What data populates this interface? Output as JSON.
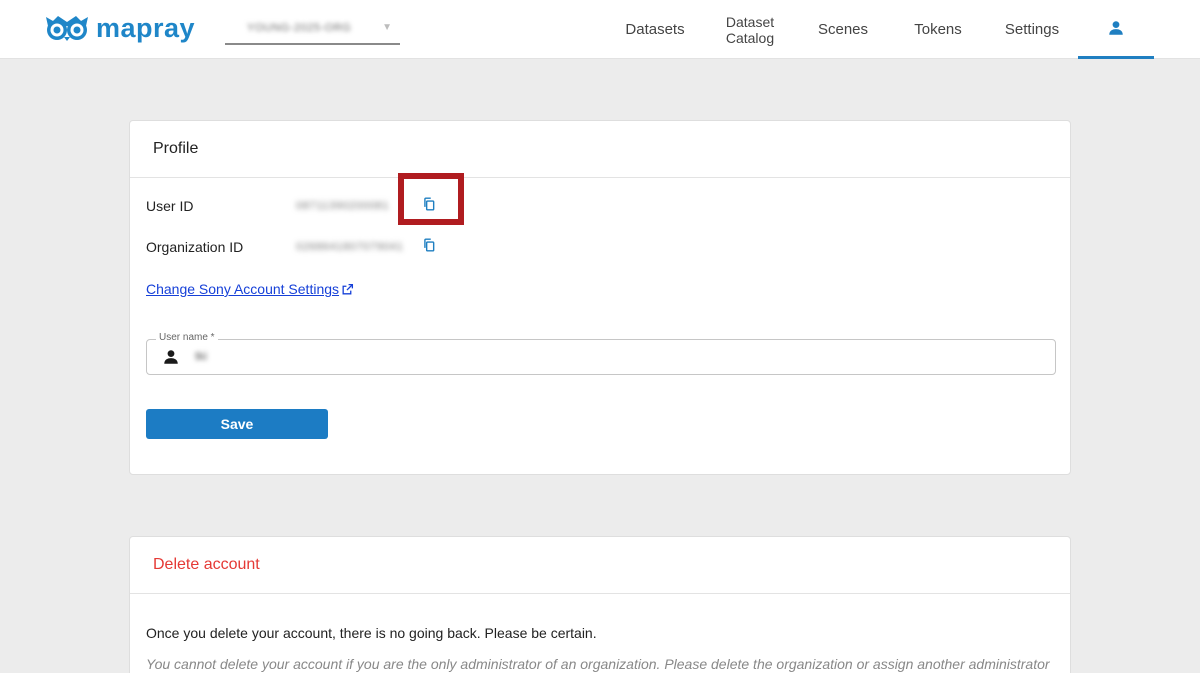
{
  "app": {
    "brand": "mapray",
    "org_selector": "YOUNG-2025-ORG",
    "colors": {
      "brand": "#1f86c8",
      "accent": "#1c7cc4",
      "danger": "#e53935",
      "link": "#1640d8",
      "highlight": "#b01c20"
    }
  },
  "nav": {
    "datasets": "Datasets",
    "dataset_catalog_line1": "Dataset",
    "dataset_catalog_line2": "Catalog",
    "scenes": "Scenes",
    "tokens": "Tokens",
    "settings": "Settings",
    "user_icon": "person-icon"
  },
  "profile": {
    "title": "Profile",
    "user_id_label": "User ID",
    "user_id_value": "08711390200081",
    "org_id_label": "Organization ID",
    "org_id_value": "0268641807079041",
    "copy_icon": "copy-icon",
    "change_link": "Change Sony Account Settings",
    "username_label": "User name *",
    "username_value": "tki",
    "save_label": "Save"
  },
  "delete_account": {
    "title": "Delete account",
    "text": "Once you delete your account, there is no going back. Please be certain.",
    "note": "You cannot delete your account if you are the only administrator of an organization. Please delete the organization or assign another administrator"
  }
}
